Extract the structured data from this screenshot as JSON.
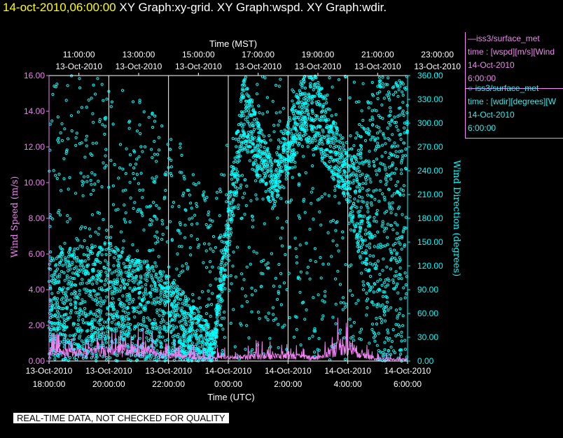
{
  "header": {
    "date_label": "14-oct-2010,06:00:00",
    "graphs_label": "XY Graph:xy-grid.  XY Graph:wspd.  XY Graph:wdir."
  },
  "legend": {
    "wspd": {
      "line1": "—iss3/surface_met",
      "line2": "time : [wspd][m/s][Wind",
      "line3": "14-Oct-2010",
      "line4": "6:00:00"
    },
    "wdir": {
      "line1": "○ iss3/surface_met",
      "line2": "time : [wdir][degrees][W",
      "line3": "14-Oct-2010",
      "line4": "6:00:00"
    }
  },
  "footer": {
    "qc_note": "REAL-TIME DATA, NOT CHECKED FOR QUALITY"
  },
  "colors": {
    "wspd": "#ee82ee",
    "wdir": "#00ffff",
    "grid": "#ffffff",
    "title_date": "#ffff00"
  },
  "chart_data": {
    "type": "scatter",
    "top_axis": {
      "label": "Time (MST)",
      "ticks": [
        {
          "time": "11:00:00",
          "date": "13-Oct-2010"
        },
        {
          "time": "13:00:00",
          "date": "13-Oct-2010"
        },
        {
          "time": "15:00:00",
          "date": "13-Oct-2010"
        },
        {
          "time": "17:00:00",
          "date": "13-Oct-2010"
        },
        {
          "time": "19:00:00",
          "date": "13-Oct-2010"
        },
        {
          "time": "21:00:00",
          "date": "13-Oct-2010"
        },
        {
          "time": "23:00:00",
          "date": "13-Oct-2010"
        }
      ]
    },
    "bottom_axis": {
      "label": "Time (UTC)",
      "range": [
        "2010-10-13 18:00",
        "2010-10-14 06:00"
      ],
      "ticks": [
        {
          "date": "13-Oct-2010",
          "time": "18:00:00"
        },
        {
          "date": "13-Oct-2010",
          "time": "20:00:00"
        },
        {
          "date": "13-Oct-2010",
          "time": "22:00:00"
        },
        {
          "date": "14-Oct-2010",
          "time": "0:00:00"
        },
        {
          "date": "14-Oct-2010",
          "time": "2:00:00"
        },
        {
          "date": "14-Oct-2010",
          "time": "4:00:00"
        },
        {
          "date": "14-Oct-2010",
          "time": "6:00:00"
        }
      ]
    },
    "left_axis": {
      "label": "Wind Speed (m/s)",
      "ylim": [
        0,
        16
      ],
      "tick_labels": [
        "0.00",
        "2.00",
        "4.00",
        "6.00",
        "8.00",
        "10.00",
        "12.00",
        "14.00",
        "16.00"
      ]
    },
    "right_axis": {
      "label": "Wind Direction (degrees)",
      "ylim": [
        0,
        360
      ],
      "tick_labels": [
        "0.00",
        "30.00",
        "60.00",
        "90.00",
        "120.00",
        "150.00",
        "180.00",
        "210.00",
        "240.00",
        "270.00",
        "300.00",
        "330.00",
        "360.00"
      ]
    },
    "grid": true,
    "series": [
      {
        "key": "wspd",
        "style": "line",
        "color": "#ee82ee",
        "axis": "left",
        "profile": [
          {
            "utc": "18:00",
            "typical": 0.5,
            "peak": 1.8
          },
          {
            "utc": "19:00",
            "typical": 0.5,
            "peak": 1.5
          },
          {
            "utc": "20:00",
            "typical": 0.6,
            "peak": 1.8
          },
          {
            "utc": "21:00",
            "typical": 0.7,
            "peak": 2.2
          },
          {
            "utc": "22:00",
            "typical": 0.4,
            "peak": 1.4
          },
          {
            "utc": "23:00",
            "typical": 0.2,
            "peak": 0.8
          },
          {
            "utc": "00:00",
            "typical": 0.2,
            "peak": 0.8
          },
          {
            "utc": "01:00",
            "typical": 0.3,
            "peak": 1.3
          },
          {
            "utc": "02:00",
            "typical": 0.3,
            "peak": 1.0
          },
          {
            "utc": "03:00",
            "typical": 0.2,
            "peak": 0.9
          },
          {
            "utc": "03:50",
            "typical": 1.0,
            "peak": 3.2
          },
          {
            "utc": "04:30",
            "typical": 0.4,
            "peak": 1.2
          },
          {
            "utc": "05:00",
            "typical": 0.1,
            "peak": 0.5
          },
          {
            "utc": "06:00",
            "typical": 0.1,
            "peak": 0.4
          }
        ]
      },
      {
        "key": "wdir",
        "style": "circles",
        "color": "#00ffff",
        "axis": "right",
        "profile": [
          {
            "utc": "18:00",
            "dense_low": 0,
            "dense_high": 140,
            "scatter_high": 360
          },
          {
            "utc": "20:00",
            "dense_low": 0,
            "dense_high": 150,
            "scatter_high": 360
          },
          {
            "utc": "22:00",
            "dense_low": 0,
            "dense_high": 110,
            "scatter_high": 300
          },
          {
            "utc": "23:30",
            "dense_low": 0,
            "dense_high": 40,
            "scatter_high": 200
          },
          {
            "utc": "00:30",
            "dense_low": 270,
            "dense_high": 360,
            "scatter_high": 360
          },
          {
            "utc": "01:30",
            "dense_low": 190,
            "dense_high": 250,
            "scatter_high": 360
          },
          {
            "utc": "02:30",
            "dense_low": 280,
            "dense_high": 360,
            "scatter_high": 360
          },
          {
            "utc": "03:00",
            "dense_low": 260,
            "dense_high": 360,
            "scatter_high": 360
          },
          {
            "utc": "04:00",
            "dense_low": 200,
            "dense_high": 260,
            "scatter_high": 360
          },
          {
            "utc": "05:00",
            "dense_low": 0,
            "dense_high": 360,
            "scatter_high": 360
          },
          {
            "utc": "06:00",
            "dense_low": 0,
            "dense_high": 360,
            "scatter_high": 360
          }
        ]
      }
    ]
  }
}
